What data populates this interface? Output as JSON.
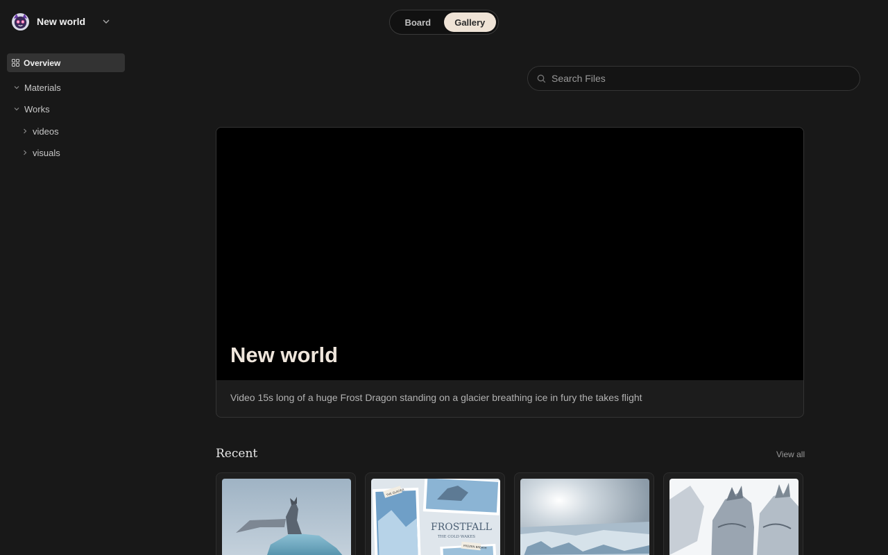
{
  "workspace": {
    "name": "New world"
  },
  "sidebar": {
    "overview": "Overview",
    "tree": [
      {
        "label": "Materials",
        "expanded": true
      },
      {
        "label": "Works",
        "expanded": true
      },
      {
        "label": "videos",
        "expanded": false
      },
      {
        "label": "visuals",
        "expanded": false
      }
    ]
  },
  "view_toggle": {
    "board": "Board",
    "gallery": "Gallery",
    "active": "Gallery"
  },
  "search": {
    "placeholder": "Search Files",
    "value": ""
  },
  "hero": {
    "title": "New world",
    "description": "Video 15s long of a huge Frost Dragon standing on a glacier breathing ice in fury the takes flight"
  },
  "recent": {
    "title": "Recent",
    "view_all": "View all",
    "cards": [
      {
        "thumb": "dragon-on-ice-cliff"
      },
      {
        "thumb": "frostfall-collage",
        "poster_title": "FROSTFALL",
        "poster_subtitle": "THE COLD WAKES",
        "tag_top": "THE GLACIER",
        "tag_bottom": "FROZEN BREATH"
      },
      {
        "thumb": "frozen-landscape"
      },
      {
        "thumb": "white-dragon-illustration"
      }
    ]
  },
  "colors": {
    "background": "#181818",
    "accent_active": "#efe3d6",
    "sidebar_active": "#333333"
  }
}
